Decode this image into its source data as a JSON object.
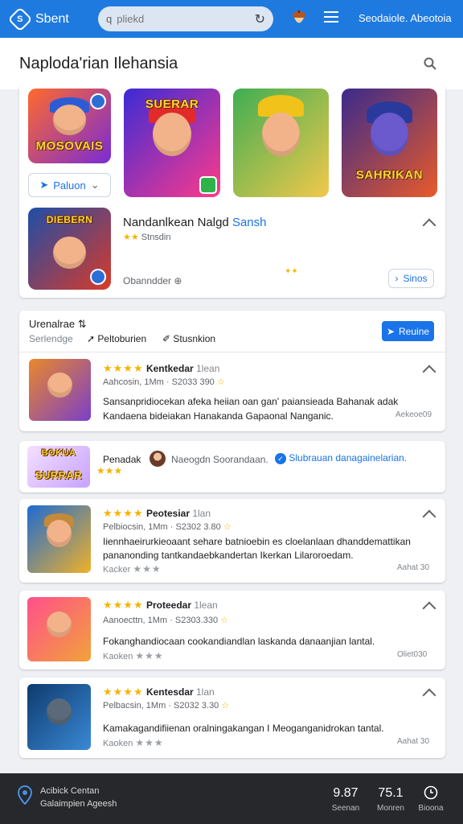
{
  "topbar": {
    "logo_glyph": "S",
    "brand": "Sbent",
    "search_placeholder": "pliekd",
    "nav_link": "Seodaiole. Abeotoia"
  },
  "page": {
    "title": "Naploda'rian Ilehansia"
  },
  "featured": {
    "tiles": [
      {
        "caption": "MOSOVAIS",
        "colors": [
          "#ff6a2b",
          "#7a2bd6"
        ]
      },
      {
        "caption": "SUERAR",
        "colors": [
          "#3b2bd6",
          "#ff3a8a"
        ]
      },
      {
        "caption": "",
        "colors": [
          "#3fae52",
          "#f2c84b"
        ]
      },
      {
        "caption": "SAHRIKAN",
        "colors": [
          "#3a2a8c",
          "#e85a2a"
        ]
      }
    ],
    "dropdown_label": "Paluon",
    "spotlight": {
      "title": "Nandanlkean Nalgd",
      "highlight": "Sansh",
      "meta": "Stnsdin",
      "footer_text": "Obanndder",
      "action_label": "Sinos",
      "caption": "DIEBERN"
    }
  },
  "review_header": {
    "title": "Urenalrae",
    "filters": [
      "Serlendge",
      "Peltoburien",
      "Stusnkion"
    ],
    "button_label": "Reuine"
  },
  "reviews": [
    {
      "name": "Kentkedar",
      "time": "1lean",
      "meta": "Aahcosin, 1Mm · S2033 390",
      "body": [
        "Sansanpridiocekan afeka heiian oan gan' paiansieada Bahanak adak",
        "Kandaena bideiakan Hanakanda Gapaonal Nanganic."
      ],
      "right_label": "Aekeoe09",
      "colors": [
        "#e9882a",
        "#7b3fc9"
      ]
    },
    {
      "name": "Peotesiar",
      "time": "1lan",
      "meta": "Pelbiocsin, 1Mm · S2302 3.80",
      "body": [
        "Iiennhaeirurkieoaant sehare batnioebin es cloelanlaan dhanddemattikan",
        "pananonding tantkandaebkandertan Ikerkan Lilaroroedam."
      ],
      "reviewer": "Kacker",
      "right_label": "Aahat 30",
      "colors": [
        "#1d6bd1",
        "#f0b12a"
      ]
    },
    {
      "name": "Proteedar",
      "time": "1lean",
      "meta": "Aanoecttn, 1Mm · S2303.330",
      "body": [
        "Fokanghandiocaan cookandiandlan laskanda danaanjian lantal."
      ],
      "reviewer": "Kaoken",
      "right_label": "Oliet030",
      "colors": [
        "#ff4f8b",
        "#f2a23a"
      ]
    },
    {
      "name": "Kentesdar",
      "time": "1lan",
      "meta": "Pelbacsin, 1Mm · S2032 3.30",
      "body": [
        "Kamakagandifiienan oralningakangan I Meoganganidrokan tantal."
      ],
      "reviewer": "Kaoken",
      "right_label": "Aahat 30",
      "colors": [
        "#0e3a6e",
        "#3a8ad6"
      ]
    }
  ],
  "promo": {
    "tile_caption": "SURRAR",
    "tile_top": "BOKUA",
    "label": "Penadak",
    "text": "Naeogdn Soorandaan.",
    "link": "Slubrauan danagainelarian."
  },
  "footer": {
    "title": "Acibick Centan",
    "subtitle": "Galaimpien Ageesh",
    "stats": [
      {
        "value": "9.87",
        "label": "Seenan"
      },
      {
        "value": "75.1",
        "label": "Monren"
      },
      {
        "label": "Bioona"
      }
    ]
  }
}
